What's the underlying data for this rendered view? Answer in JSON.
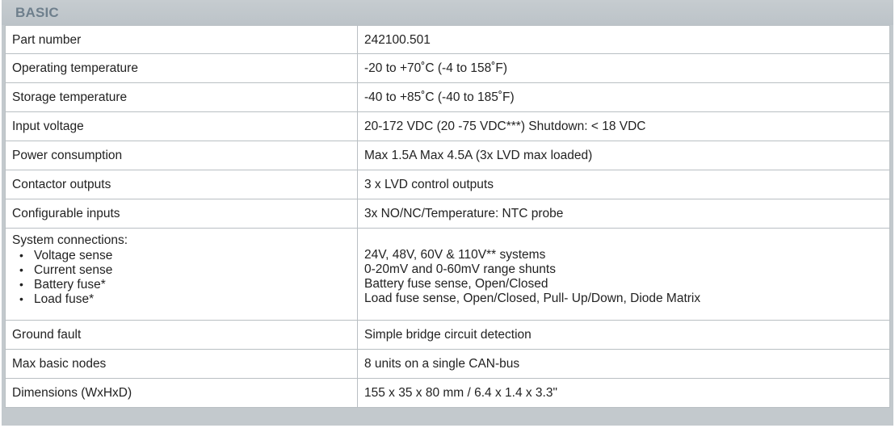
{
  "section": {
    "title": "BASIC"
  },
  "rows": [
    {
      "label": "Part number",
      "value": "242100.501"
    },
    {
      "label": "Operating temperature",
      "value": "-20 to +70˚C (-4 to 158˚F)"
    },
    {
      "label": "Storage temperature",
      "value": "-40 to +85˚C (-40 to 185˚F)"
    },
    {
      "label": "Input voltage",
      "value": "20-172 VDC (20 -75 VDC***) Shutdown: < 18 VDC"
    },
    {
      "label": "Power consumption",
      "value": "Max 1.5A Max 4.5A (3x LVD max loaded)"
    },
    {
      "label": "Contactor outputs",
      "value": "3 x LVD control outputs"
    },
    {
      "label": "Configurable inputs",
      "value": "3x NO/NC/Temperature: NTC probe"
    }
  ],
  "system_connections": {
    "label": "System connections:",
    "bullet": "•",
    "items": [
      {
        "label": "Voltage sense",
        "value": "24V, 48V, 60V & 110V** systems"
      },
      {
        "label": "Current sense",
        "value": "0-20mV and 0-60mV range shunts"
      },
      {
        "label": "Battery fuse*",
        "value": "Battery fuse sense, Open/Closed"
      },
      {
        "label": "Load fuse*",
        "value": "Load fuse sense, Open/Closed, Pull- Up/Down, Diode Matrix"
      }
    ]
  },
  "rows_after": [
    {
      "label": "Ground fault",
      "value": "Simple bridge circuit detection"
    },
    {
      "label": "Max basic nodes",
      "value": "8 units on a single CAN-bus"
    },
    {
      "label": "Dimensions (WxHxD)",
      "value": "155 x 35 x 80 mm / 6.4 x 1.4 x 3.3\""
    }
  ],
  "colors": {
    "header_bg": "#c0c6cb",
    "header_text": "#6e7f8c",
    "grid_line": "#b9bfc3",
    "cell_bg": "#ffffff",
    "text": "#222222"
  }
}
